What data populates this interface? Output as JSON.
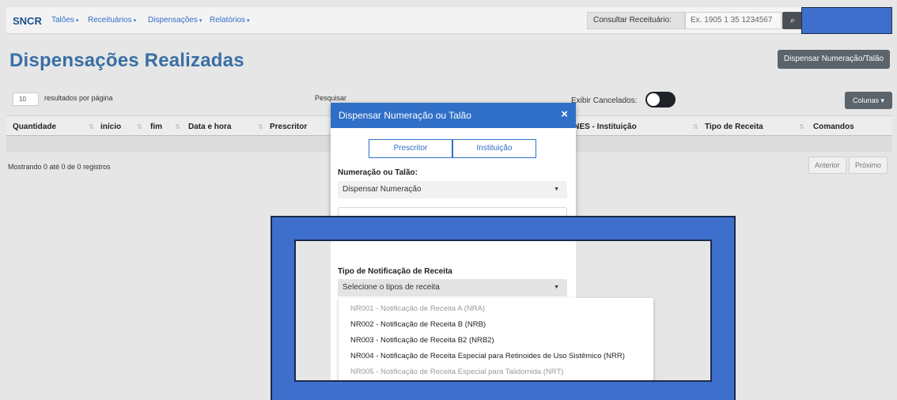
{
  "navbar": {
    "brand": "SNCR",
    "menu": [
      {
        "label": "Talões"
      },
      {
        "label": "Receituários"
      },
      {
        "label": "Dispensações"
      },
      {
        "label": "Relatórios"
      }
    ],
    "consult_label": "Consultar Receituário:",
    "consult_placeholder": "Ex. 1905 1 35 1234567"
  },
  "page": {
    "title": "Dispensações Realizadas",
    "dispense_button": "Dispensar Numeração/Talão",
    "per_page_value": "10",
    "per_page_label": "resultados por página",
    "search_label": "Pesquisar",
    "show_cancelled_label": "Exibir Cancelados:",
    "columns_button": "Colunas",
    "table_headers": [
      "Quantidade",
      "início",
      "fim",
      "Data e hora",
      "Prescritor",
      "CNES - Instituição",
      "Tipo de Receita",
      "Comandos"
    ],
    "table_info": "Mostrando 0 até 0 de 0 registros",
    "pager_prev": "Anterior",
    "pager_next": "Próximo"
  },
  "modal": {
    "title": "Dispensar Numeração ou Talão",
    "close": "×",
    "seg_prescritor": "Prescritor",
    "seg_instituicao": "Instituição",
    "numeracao_label": "Numeração ou Talão:",
    "numeracao_value": "Dispensar Numeração",
    "tipo_label": "Tipo de Notificação de Receita",
    "tipo_placeholder": "Selecione o tipos de receita",
    "options": [
      "NR001 - Notificação de Receita A (NRA)",
      "NR002 - Notificação de Receita B (NRB)",
      "NR003 - Notificação de Receita B2 (NRB2)",
      "NR004 - Notificação de Receita Especial para Retinoides de Uso Sistêmico (NRR)",
      "NR005 - Notificação de Receita Especial para Talidomida (NRT)"
    ]
  },
  "colors": {
    "primary": "#2f6fc7",
    "overlay": "#3f6fcc",
    "secondary": "#5b636b"
  }
}
